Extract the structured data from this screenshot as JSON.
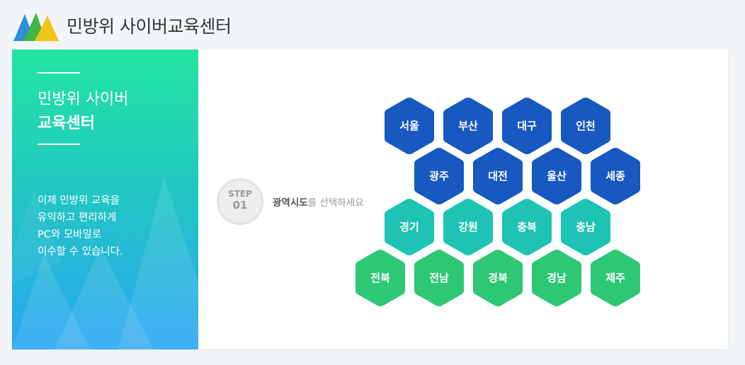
{
  "header": {
    "title": "민방위 사이버교육센터",
    "logo_icon": "mountain-logo-icon"
  },
  "sidebar": {
    "title_line1": "민방위 사이버",
    "title_line2": "교육센터",
    "description": "이제 민방위 교육을\n유익하고 편리하게\nPC와 모바일로\n이수할 수 있습니다."
  },
  "step": {
    "label": "STEP",
    "number": "01",
    "instruction_bold": "광역시도",
    "instruction_rest": "를 선택하세요"
  },
  "colors": {
    "row1": "#1758c1",
    "row2": "#1758c1",
    "row3": "#1ec3b4",
    "row4": "#2ec775"
  },
  "regions": [
    [
      "서울",
      "부산",
      "대구",
      "인천"
    ],
    [
      "광주",
      "대전",
      "울산",
      "세종"
    ],
    [
      "경기",
      "강원",
      "충북",
      "충남"
    ],
    [
      "전북",
      "전남",
      "경북",
      "경남",
      "제주"
    ]
  ]
}
